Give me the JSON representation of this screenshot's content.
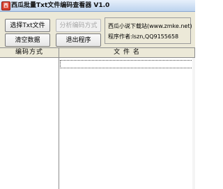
{
  "window": {
    "title": "西瓜批量Txt文件编码查看器 V1.0",
    "icon": "app-icon"
  },
  "toolbar": {
    "select_txt_label": "选择Txt文件",
    "analyze_encoding_label": "分析编码方式",
    "clear_data_label": "清空数据",
    "exit_label": "退出程序"
  },
  "info": {
    "site_line": "西瓜小说下载站(www.zmke.net)",
    "author_line": "程序作者:lszn,QQ9155658"
  },
  "table": {
    "columns": [
      "编码方式",
      "文 件 名"
    ],
    "rows": []
  }
}
